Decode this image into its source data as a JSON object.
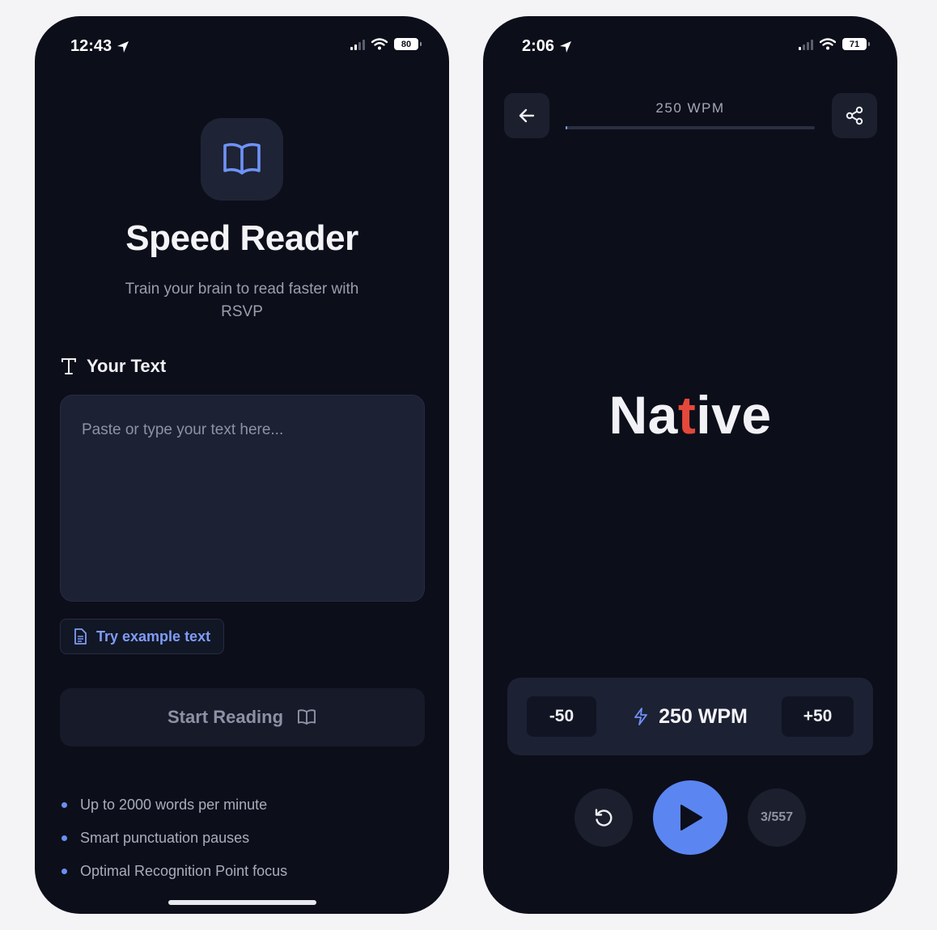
{
  "left_phone": {
    "status_bar": {
      "time": "12:43",
      "battery": "80"
    },
    "app_icon": "open-book-icon",
    "title": "Speed Reader",
    "subtitle": "Train your brain to read faster with RSVP",
    "text_section": {
      "label": "Your Text",
      "icon": "text-type-icon",
      "placeholder": "Paste or type your text here..."
    },
    "example_button": {
      "label": "Try example text",
      "icon": "document-icon"
    },
    "start_button": {
      "label": "Start Reading",
      "icon": "open-book-icon"
    },
    "features": [
      "Up to 2000 words per minute",
      "Smart punctuation pauses",
      "Optimal Recognition Point focus"
    ]
  },
  "right_phone": {
    "status_bar": {
      "time": "2:06",
      "battery": "71"
    },
    "header": {
      "wpm": "250 WPM",
      "back_icon": "arrow-left-icon",
      "share_icon": "share-icon"
    },
    "progress": 0.005,
    "word": {
      "before": "Na",
      "focus": "t",
      "after": "ive"
    },
    "controls": {
      "decrease": "-50",
      "wpm": "250 WPM",
      "increase": "+50",
      "wpm_icon": "lightning-icon",
      "restart_icon": "restart-icon",
      "play_icon": "play-icon",
      "counter": "3/557"
    }
  },
  "colors": {
    "background": "#f4f4f7",
    "phone": "#0c0e1a",
    "accent": "#5b86f1",
    "focus_letter": "#e5483a"
  }
}
